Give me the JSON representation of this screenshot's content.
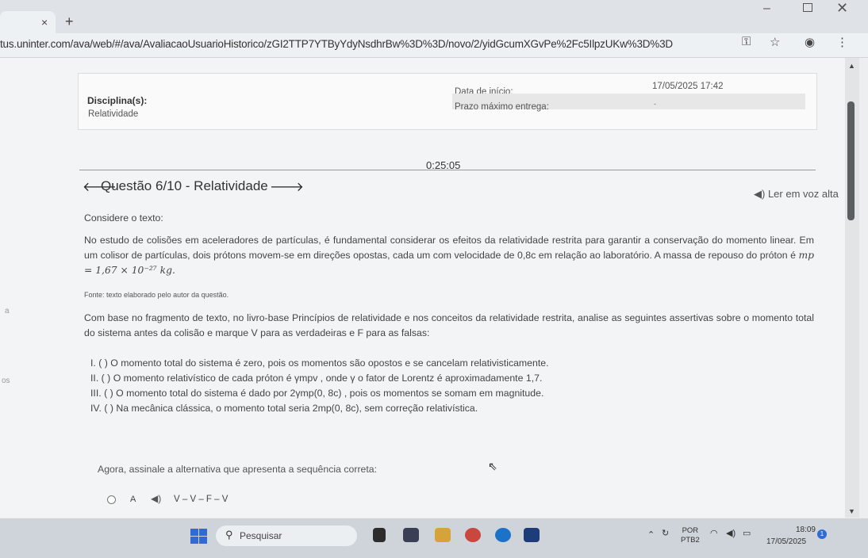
{
  "browser": {
    "tab_close": "×",
    "new_tab": "+",
    "url": "tus.uninter.com/ava/web/#/ava/AvaliacaoUsuarioHistorico/zGI2TTP7YTByYdyNsdhrBw%3D%3D/novo/2/yidGcumXGvPe%2Fc5IlpzUKw%3D%3D",
    "minimize": "–",
    "close": "✕"
  },
  "info": {
    "discipline_label": "Disciplina(s):",
    "discipline_value": "Relatividade",
    "start_label": "Data de início:",
    "start_value": "17/05/2025 17:42",
    "deadline_label": "Prazo máximo entrega:",
    "deadline_value": "-"
  },
  "timer": "0:25:05",
  "question": {
    "title": "Questão 6/10 - Relatividade",
    "read_aloud": "Ler em voz alta",
    "intro": "Considere o texto:",
    "paragraph": "No estudo de colisões em aceleradores de partículas, é fundamental considerar os efeitos da relatividade restrita para garantir a conservação do momento linear. Em um colisor de partículas, dois prótons movem-se em direções opostas, cada um com velocidade de 0,8c em relação ao laboratório. A massa de repouso do próton é",
    "mass_formula": "mp = 1,67 × 10⁻²⁷ kg.",
    "source": "Fonte: texto elaborado pelo autor da questão.",
    "instruction": "Com base no fragmento de texto, no livro-base Princípios de relatividade e nos conceitos da relatividade restrita, analise as seguintes assertivas sobre o momento total do sistema antes da colisão e marque V para as verdadeiras e F para as falsas:",
    "statements": [
      "I. ( ) O momento total do sistema é zero, pois os momentos são opostos e se cancelam relativisticamente.",
      "II. ( ) O momento relativístico de cada próton é γmpv , onde γ o fator de Lorentz é aproximadamente 1,7.",
      "III. ( ) O momento total do sistema é dado por 2γmp(0, 8c) , pois os momentos se somam em magnitude.",
      "IV. ( ) Na mecânica clássica, o momento total seria 2mp(0, 8c), sem correção relativística."
    ],
    "prompt": "Agora, assinale a alternativa que apresenta a sequência correta:",
    "options": [
      {
        "letter": "A",
        "text": "V – V – F – V"
      }
    ]
  },
  "side_fragments": {
    "a": "a",
    "s": "os"
  },
  "taskbar": {
    "search": "Pesquisar",
    "lang_1": "POR",
    "lang_2": "PTB2",
    "time": "18:09",
    "date": "17/05/2025",
    "notifications": "1"
  },
  "colors": {
    "accent": "#2f6bd6",
    "page_bg": "#f3f4f5",
    "taskbar": "#cfd4da"
  }
}
